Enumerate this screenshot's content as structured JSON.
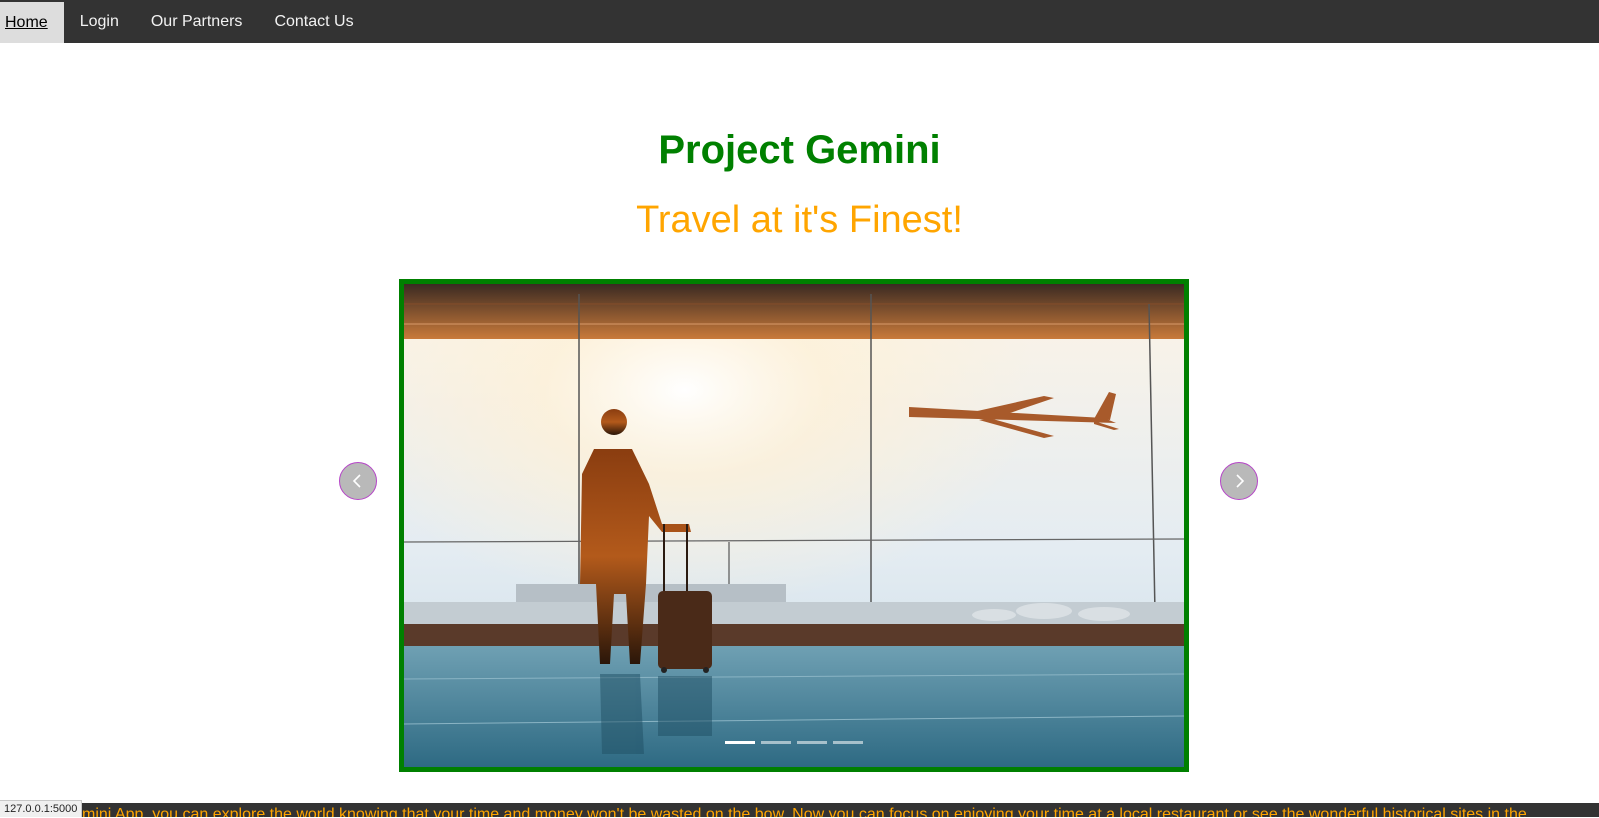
{
  "nav": {
    "items": [
      {
        "label": "Home",
        "active": true
      },
      {
        "label": "Login",
        "active": false
      },
      {
        "label": "Our Partners",
        "active": false
      },
      {
        "label": "Contact Us",
        "active": false
      }
    ]
  },
  "hero": {
    "title": "Project Gemini",
    "subtitle": "Travel at it's Finest!"
  },
  "colors": {
    "nav_bg": "#333333",
    "title": "#008000",
    "subtitle": "#ffa500",
    "slideshow_border": "#008000",
    "arrow_bg": "#b9b9b9",
    "arrow_border": "#b545c7"
  },
  "slideshow": {
    "current_slide": 1,
    "slide_count": 4,
    "icons": {
      "prev": "chevron-left-icon",
      "next": "chevron-right-icon"
    }
  },
  "marquee": {
    "text": "mini App, you can explore the world knowing that your time and money won't be wasted on the bow. Now you can focus on enjoying your time at a local restaurant or see the wonderful historical sites in the"
  },
  "status_bar": {
    "url": "127.0.0.1:5000"
  }
}
